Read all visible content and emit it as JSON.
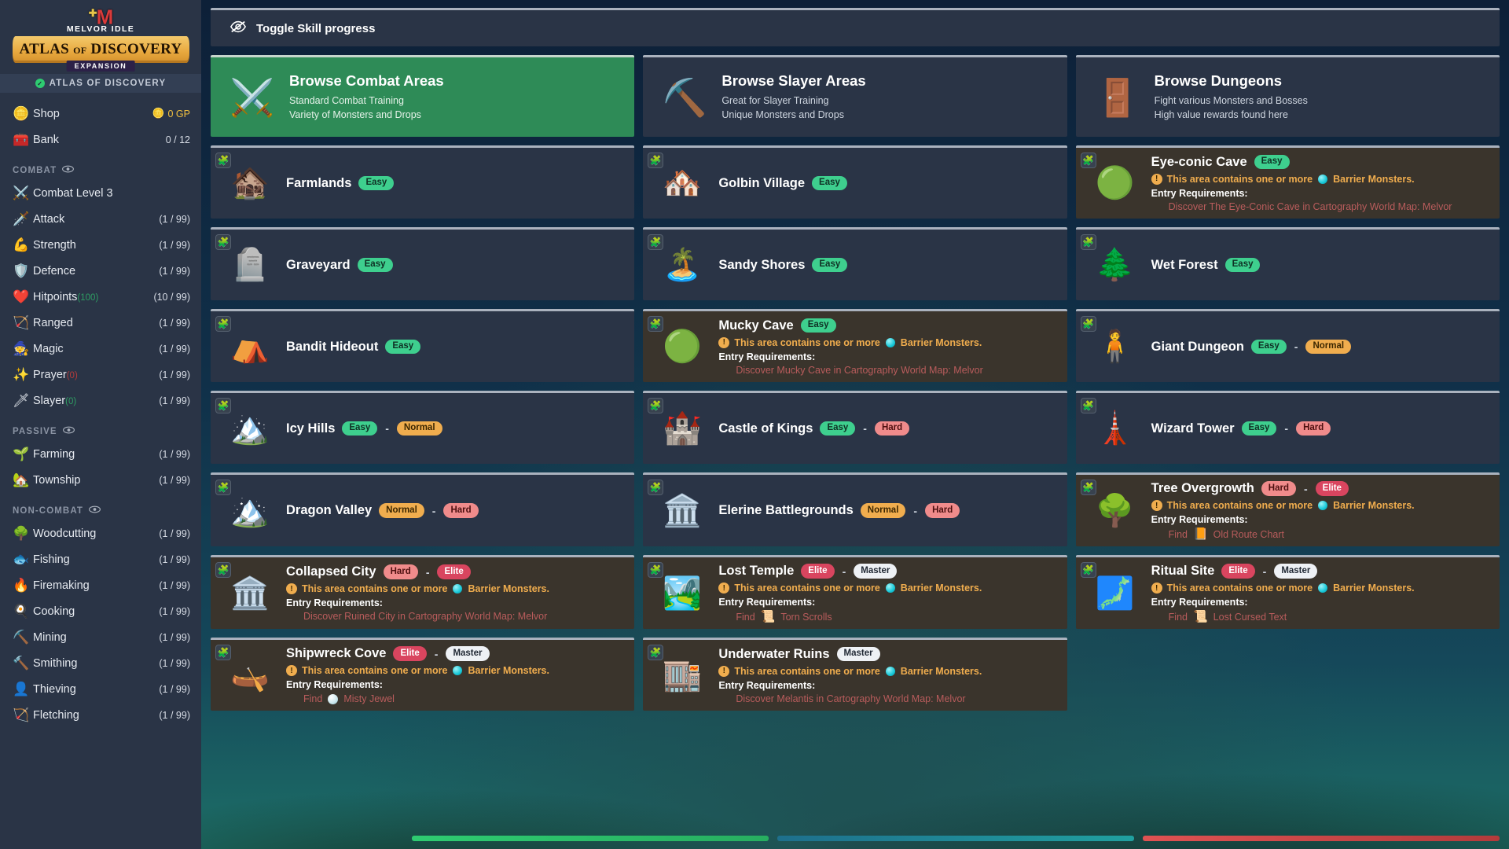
{
  "brand": {
    "logo_m": "M",
    "title_top": "MELVOR IDLE",
    "banner": "ATLAS OF DISCOVERY",
    "banner_word1": "ATLAS",
    "banner_of": "OF",
    "banner_word2": "DISCOVERY",
    "expansion": "EXPANSION",
    "active_expansion": "ATLAS OF DISCOVERY"
  },
  "sidebar": {
    "top_items": [
      {
        "icon": "coin-icon",
        "glyph": "🪙",
        "label": "Shop",
        "right_glyph": "🪙",
        "right": "0 GP",
        "gp": true
      },
      {
        "icon": "chest-icon",
        "glyph": "🧰",
        "label": "Bank",
        "right": "0 / 12",
        "gp": false
      }
    ],
    "sections": [
      {
        "header": "COMBAT",
        "items": [
          {
            "icon": "crossed-swords-icon",
            "glyph": "⚔️",
            "label": "Combat Level 3",
            "right": ""
          },
          {
            "icon": "sword-icon",
            "glyph": "🗡️",
            "label": "Attack",
            "right": "(1 / 99)"
          },
          {
            "icon": "flexed-biceps-icon",
            "glyph": "💪",
            "label": "Strength",
            "right": "(1 / 99)"
          },
          {
            "icon": "shield-icon",
            "glyph": "🛡️",
            "label": "Defence",
            "right": "(1 / 99)"
          },
          {
            "icon": "heart-icon",
            "glyph": "❤️",
            "label": "Hitpoints",
            "suffix": "(100)",
            "suffix_color": "green",
            "right": "(10 / 99)"
          },
          {
            "icon": "bow-icon",
            "glyph": "🏹",
            "label": "Ranged",
            "right": "(1 / 99)"
          },
          {
            "icon": "wizard-hat-icon",
            "glyph": "🧙",
            "label": "Magic",
            "right": "(1 / 99)"
          },
          {
            "icon": "sparkle-icon",
            "glyph": "✨",
            "label": "Prayer",
            "suffix": "(0)",
            "suffix_color": "red",
            "right": "(1 / 99)"
          },
          {
            "icon": "slayer-icon",
            "glyph": "🗡",
            "label": "Slayer",
            "suffix": "(0)",
            "suffix_color": "green",
            "right": "(1 / 99)"
          }
        ]
      },
      {
        "header": "PASSIVE",
        "items": [
          {
            "icon": "seedling-icon",
            "glyph": "🌱",
            "label": "Farming",
            "right": "(1 / 99)"
          },
          {
            "icon": "township-icon",
            "glyph": "🏡",
            "label": "Township",
            "right": "(1 / 99)"
          }
        ]
      },
      {
        "header": "NON-COMBAT",
        "items": [
          {
            "icon": "tree-icon",
            "glyph": "🌳",
            "label": "Woodcutting",
            "right": "(1 / 99)"
          },
          {
            "icon": "fish-icon",
            "glyph": "🐟",
            "label": "Fishing",
            "right": "(1 / 99)"
          },
          {
            "icon": "fire-icon",
            "glyph": "🔥",
            "label": "Firemaking",
            "right": "(1 / 99)"
          },
          {
            "icon": "cooking-icon",
            "glyph": "🍳",
            "label": "Cooking",
            "right": "(1 / 99)"
          },
          {
            "icon": "pickaxe-icon",
            "glyph": "⛏️",
            "label": "Mining",
            "right": "(1 / 99)"
          },
          {
            "icon": "anvil-icon",
            "glyph": "🔨",
            "label": "Smithing",
            "right": "(1 / 99)"
          },
          {
            "icon": "thieving-icon",
            "glyph": "👤",
            "label": "Thieving",
            "right": "(1 / 99)"
          },
          {
            "icon": "fletching-icon",
            "glyph": "🏹",
            "label": "Fletching",
            "right": "(1 / 99)"
          }
        ]
      }
    ]
  },
  "main": {
    "toggle": {
      "label": "Toggle Skill progress",
      "icon": "eye-slash-icon"
    },
    "browse_cards": [
      {
        "icon": "crossed-swords-icon",
        "glyph": "⚔️",
        "title": "Browse Combat Areas",
        "line1": "Standard Combat Training",
        "line2": "Variety of Monsters and Drops",
        "active": true
      },
      {
        "icon": "slayer-sword-rock-icon",
        "glyph": "⛏️",
        "title": "Browse Slayer Areas",
        "line1": "Great for Slayer Training",
        "line2": "Unique Monsters and Drops",
        "active": false
      },
      {
        "icon": "dungeon-door-icon",
        "glyph": "🚪",
        "title": "Browse Dungeons",
        "line1": "Fight various Monsters and Bosses",
        "line2": "High value rewards found here",
        "active": false
      }
    ],
    "warning_prefix": "This area contains one or more",
    "barrier_label": "Barrier Monsters.",
    "entry_req_label": "Entry Requirements:",
    "find_label": "Find",
    "realm_badge_glyph": "🧩",
    "areas": [
      {
        "name": "Farmlands",
        "glyph": "🏚️",
        "icon": "barn-icon",
        "badges": [
          "Easy"
        ],
        "locked": false
      },
      {
        "name": "Golbin Village",
        "glyph": "🏘️",
        "icon": "village-icon",
        "badges": [
          "Easy"
        ],
        "locked": false
      },
      {
        "name": "Eye-conic Cave",
        "glyph": "🟢",
        "icon": "cave-icon",
        "badges": [
          "Easy"
        ],
        "locked": true,
        "warning": true,
        "req_text": "Discover The Eye-Conic Cave in Cartography World Map: Melvor"
      },
      {
        "name": "Graveyard",
        "glyph": "🪦",
        "icon": "gravestone-icon",
        "badges": [
          "Easy"
        ],
        "locked": false
      },
      {
        "name": "Sandy Shores",
        "glyph": "🏝️",
        "icon": "beach-icon",
        "badges": [
          "Easy"
        ],
        "locked": false
      },
      {
        "name": "Wet Forest",
        "glyph": "🌲",
        "icon": "forest-icon",
        "badges": [
          "Easy"
        ],
        "locked": false
      },
      {
        "name": "Bandit Hideout",
        "glyph": "⛺",
        "icon": "tent-icon",
        "badges": [
          "Easy"
        ],
        "locked": false
      },
      {
        "name": "Mucky Cave",
        "glyph": "🟢",
        "icon": "cave-icon",
        "badges": [
          "Easy"
        ],
        "locked": true,
        "warning": true,
        "req_text": "Discover Mucky Cave in Cartography World Map: Melvor"
      },
      {
        "name": "Giant Dungeon",
        "glyph": "🧍",
        "icon": "giant-icon",
        "badges": [
          "Easy",
          "Normal"
        ],
        "locked": false
      },
      {
        "name": "Icy Hills",
        "glyph": "🏔️",
        "icon": "mountain-icon",
        "badges": [
          "Easy",
          "Normal"
        ],
        "locked": false
      },
      {
        "name": "Castle of Kings",
        "glyph": "🏰",
        "icon": "castle-icon",
        "badges": [
          "Easy",
          "Hard"
        ],
        "locked": false
      },
      {
        "name": "Wizard Tower",
        "glyph": "🗼",
        "icon": "tower-icon",
        "badges": [
          "Easy",
          "Hard"
        ],
        "locked": false
      },
      {
        "name": "Dragon Valley",
        "glyph": "🏔️",
        "icon": "valley-icon",
        "badges": [
          "Normal",
          "Hard"
        ],
        "locked": false
      },
      {
        "name": "Elerine Battlegrounds",
        "glyph": "🏛️",
        "icon": "colosseum-icon",
        "badges": [
          "Normal",
          "Hard"
        ],
        "locked": false
      },
      {
        "name": "Tree Overgrowth",
        "glyph": "🌳",
        "icon": "dead-tree-icon",
        "badges": [
          "Hard",
          "Elite"
        ],
        "locked": true,
        "warning": true,
        "find_item": {
          "glyph": "📙",
          "icon": "old-route-chart-icon",
          "name": "Old Route Chart"
        }
      },
      {
        "name": "Collapsed City",
        "glyph": "🏛️",
        "icon": "ruins-icon",
        "badges": [
          "Hard",
          "Elite"
        ],
        "locked": true,
        "warning": true,
        "req_text": "Discover Ruined City in Cartography World Map: Melvor"
      },
      {
        "name": "Lost Temple",
        "glyph": "🏞️",
        "icon": "temple-icon",
        "badges": [
          "Elite",
          "Master"
        ],
        "locked": true,
        "warning": true,
        "find_item": {
          "glyph": "📜",
          "icon": "torn-scrolls-icon",
          "name": "Torn Scrolls"
        }
      },
      {
        "name": "Ritual Site",
        "glyph": "🗾",
        "icon": "ritual-site-icon",
        "badges": [
          "Elite",
          "Master"
        ],
        "locked": true,
        "warning": true,
        "find_item": {
          "glyph": "📜",
          "icon": "lost-cursed-text-icon",
          "name": "Lost Cursed Text"
        }
      },
      {
        "name": "Shipwreck Cove",
        "glyph": "🛶",
        "icon": "shipwreck-icon",
        "badges": [
          "Elite",
          "Master"
        ],
        "locked": true,
        "warning": true,
        "find_item": {
          "glyph": "⚪",
          "icon": "misty-jewel-icon",
          "name": "Misty Jewel",
          "gem": true
        }
      },
      {
        "name": "Underwater Ruins",
        "glyph": "🏬",
        "icon": "underwater-ruins-icon",
        "badges": [
          "Master"
        ],
        "locked": true,
        "warning": true,
        "req_text": "Discover Melantis in Cartography World Map: Melvor"
      }
    ]
  },
  "colors": {
    "accent_green": "#2e8b57",
    "sidebar_bg": "#2a3446",
    "card_bg": "#2a3446",
    "locked_card_bg": "#3a342c",
    "easy": "#3ecf8e",
    "normal": "#f0ad4e",
    "hard": "#f08b8b",
    "elite": "#d9455f",
    "master": "#eef1f5",
    "warning": "#f0ad4e",
    "requirement_text": "#b95c5c"
  }
}
